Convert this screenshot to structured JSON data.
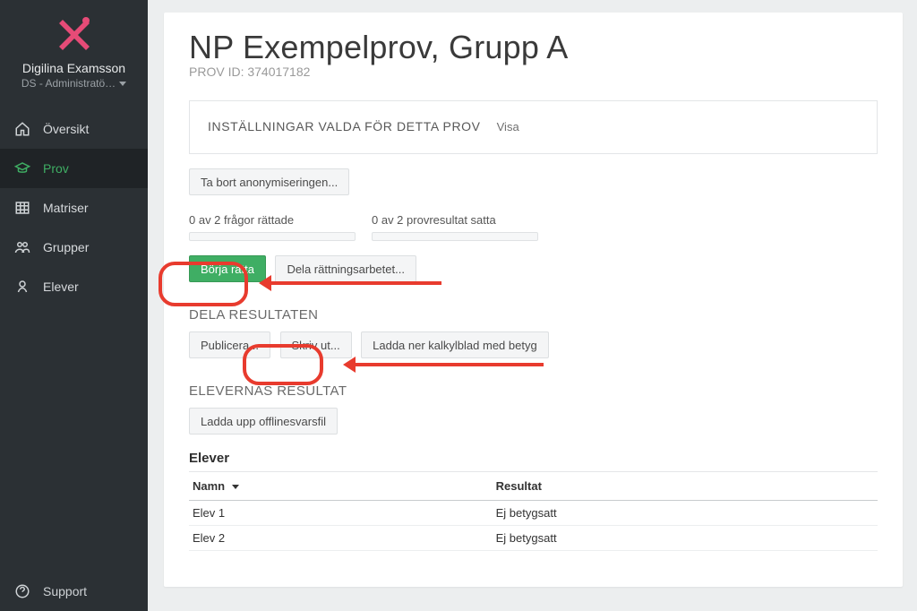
{
  "user": {
    "name": "Digilina Examsson",
    "role": "DS - Administratö…"
  },
  "nav": {
    "overview": "Översikt",
    "prov": "Prov",
    "matriser": "Matriser",
    "grupper": "Grupper",
    "elever": "Elever",
    "support": "Support"
  },
  "page": {
    "title": "NP Exempelprov, Grupp A",
    "subtitle": "PROV ID: 374017182"
  },
  "settings": {
    "label": "INSTÄLLNINGAR VALDA FÖR DETTA PROV",
    "show": "Visa"
  },
  "buttons": {
    "remove_anon": "Ta bort anonymiseringen...",
    "start_grade": "Börja rätta",
    "share_grading": "Dela rättningsarbetet...",
    "publish": "Publicera...",
    "print": "Skriv ut...",
    "download_sheet": "Ladda ner kalkylblad med betyg",
    "upload_offline": "Ladda upp offlinesvarsfil"
  },
  "progress": {
    "questions": "0 av 2 frågor rättade",
    "results": "0 av 2 provresultat satta"
  },
  "sections": {
    "share": "DELA RESULTATEN",
    "students": "ELEVERNAS RESULTAT"
  },
  "table": {
    "caption": "Elever",
    "col_name": "Namn",
    "col_result": "Resultat",
    "rows": [
      {
        "name": "Elev 1",
        "result": "Ej betygsatt"
      },
      {
        "name": "Elev 2",
        "result": "Ej betygsatt"
      }
    ]
  }
}
